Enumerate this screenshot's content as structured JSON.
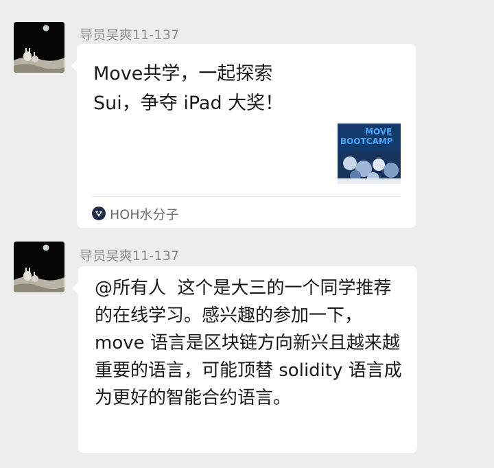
{
  "messages": [
    {
      "sender": "导员吴爽11-137",
      "type": "link-card",
      "card": {
        "title": "Move共学，一起探索 Sui，争夺 iPad 大奖！",
        "thumbnail_text": [
          "MOVE",
          "BOOTCAMP"
        ],
        "source": "HOH水分子"
      }
    },
    {
      "sender": "导员吴爽11-137",
      "type": "text",
      "text": "@所有人  这个是大三的一个同学推荐的在线学习。感兴趣的参加一下，move 语言是区块链方向新兴且越来越重要的语言，可能顶替 solidity 语言成为更好的智能合约语言。"
    }
  ],
  "colors": {
    "background": "#ededed",
    "bubble": "#ffffff",
    "sender_name": "#8f8f8f"
  }
}
